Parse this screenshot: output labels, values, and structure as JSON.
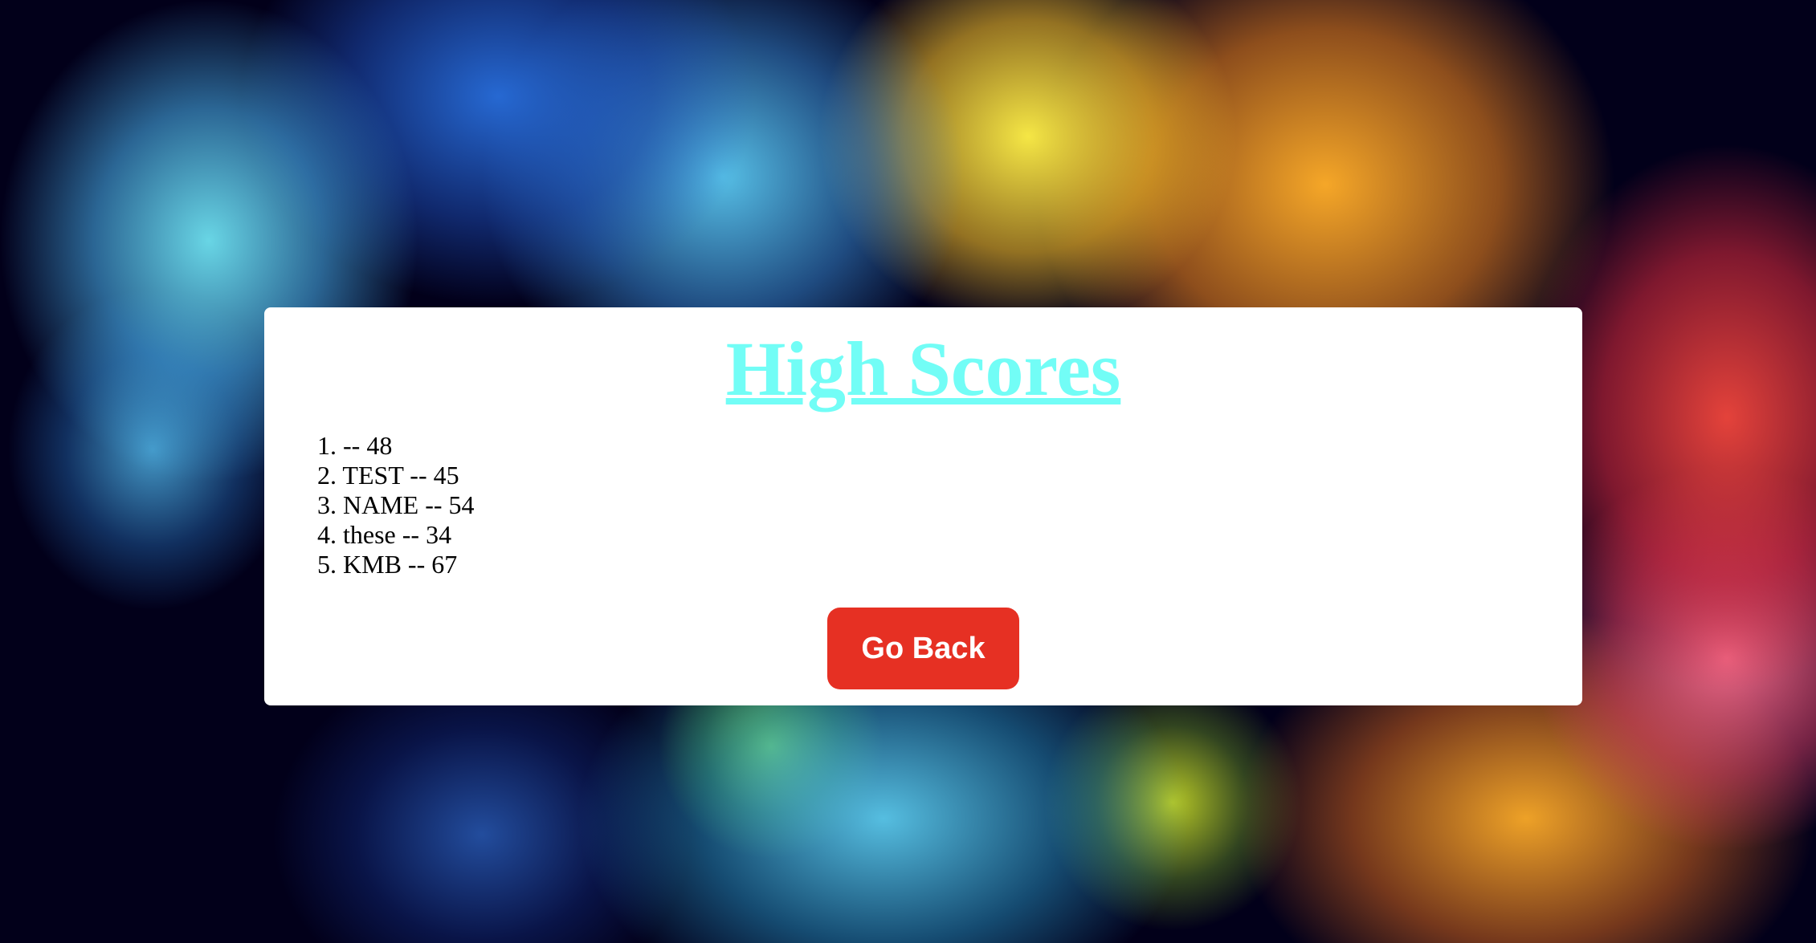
{
  "page": {
    "title": "High Scores"
  },
  "scores": [
    {
      "rank": "1.",
      "text": "-- 48"
    },
    {
      "rank": "2.",
      "text": "TEST -- 45"
    },
    {
      "rank": "3.",
      "text": "NAME -- 54"
    },
    {
      "rank": "4.",
      "text": "these -- 34"
    },
    {
      "rank": "5.",
      "text": "KMB -- 67"
    }
  ],
  "buttons": {
    "go_back": "Go Back"
  },
  "colors": {
    "title": "#72fdf6",
    "button_background": "#e63023",
    "panel_background": "#ffffff"
  }
}
